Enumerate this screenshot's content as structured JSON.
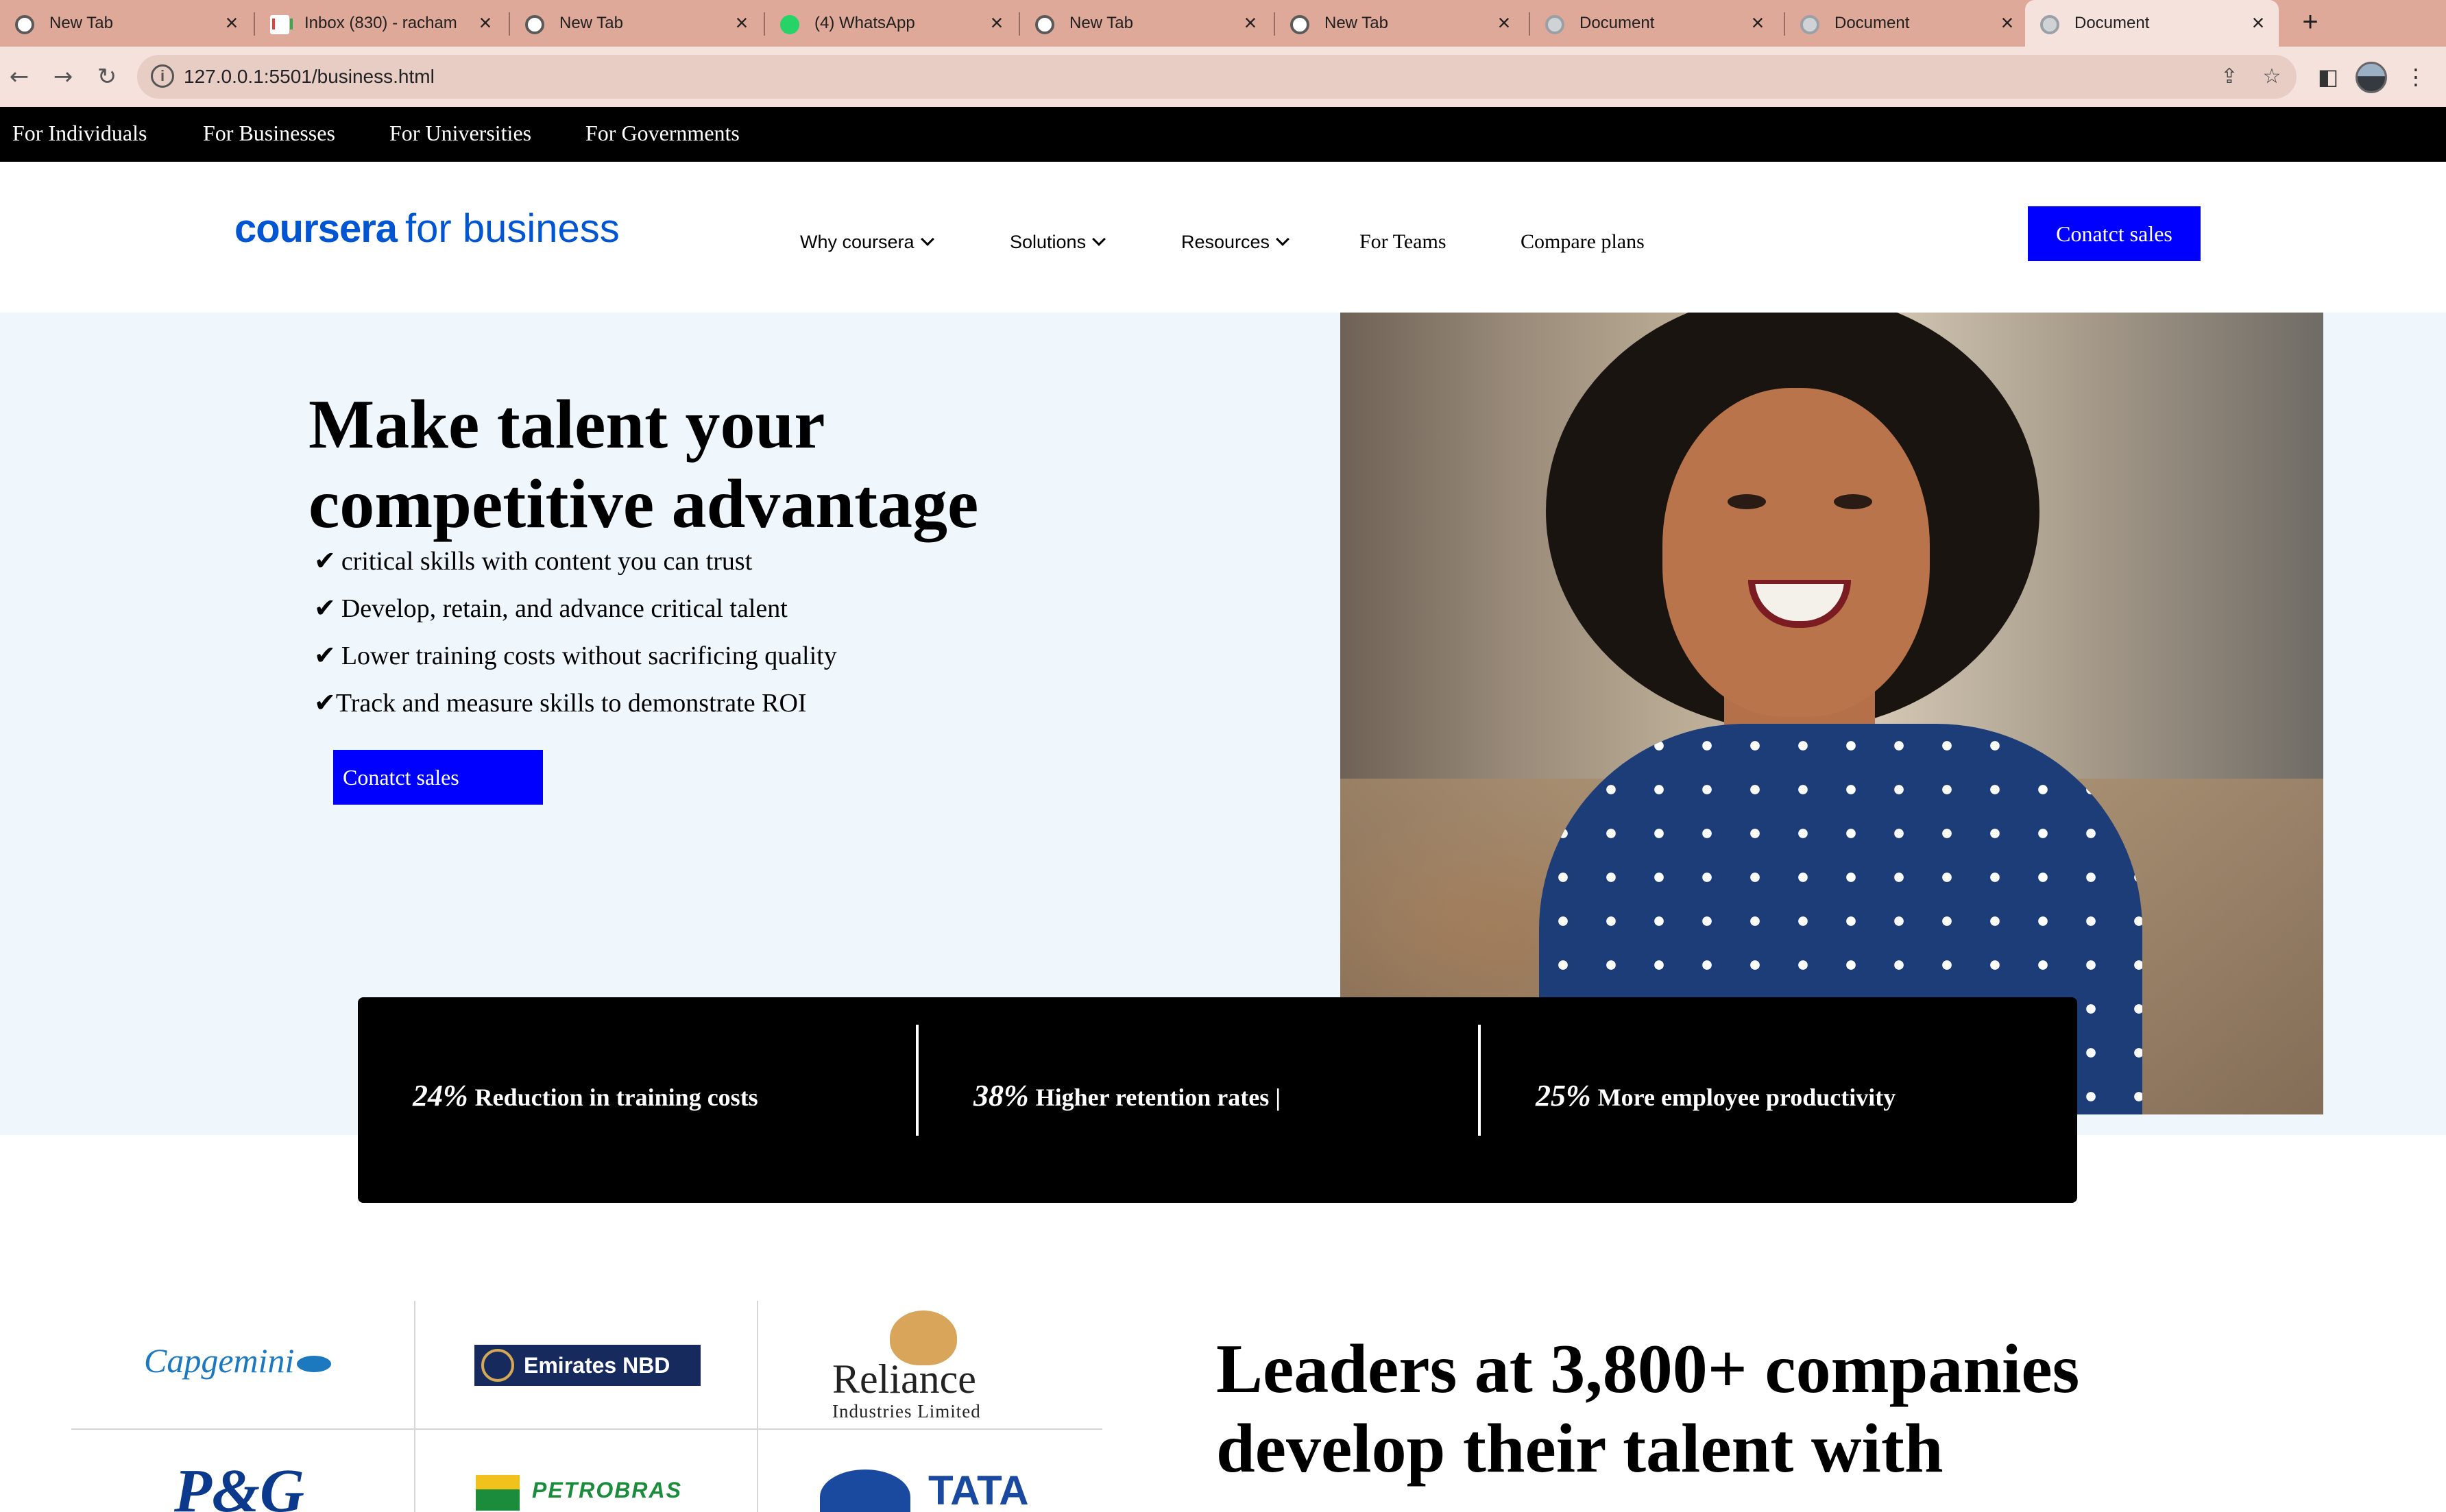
{
  "browser": {
    "tabs": [
      {
        "title": "New Tab",
        "icon": "chrome-icon"
      },
      {
        "title": "Inbox (830) - racham",
        "icon": "gmail-icon"
      },
      {
        "title": "New Tab",
        "icon": "chrome-icon"
      },
      {
        "title": "(4) WhatsApp",
        "icon": "whatsapp-icon"
      },
      {
        "title": "New Tab",
        "icon": "chrome-icon"
      },
      {
        "title": "New Tab",
        "icon": "chrome-icon"
      },
      {
        "title": "Document",
        "icon": "globe-icon"
      },
      {
        "title": "Document",
        "icon": "globe-icon"
      },
      {
        "title": "Document",
        "icon": "globe-icon",
        "active": true
      }
    ],
    "new_tab_symbol": "+",
    "close_symbol": "×",
    "url": "127.0.0.1:5501/business.html"
  },
  "audience_nav": [
    "For Individuals",
    "For Businesses",
    "For Universities",
    "For Governments"
  ],
  "header": {
    "logo_brand": "coursera",
    "logo_suffix": "for business",
    "nav": [
      {
        "label": "Why coursera",
        "dropdown": true
      },
      {
        "label": "Solutions",
        "dropdown": true
      },
      {
        "label": "Resources",
        "dropdown": true
      },
      {
        "label": "For Teams",
        "dropdown": false
      },
      {
        "label": "Compare plans",
        "dropdown": false
      }
    ],
    "cta_label": "Conatct sales"
  },
  "hero": {
    "title": "Make talent your competitive advantage",
    "check_glyph": "✔",
    "bullets": [
      "critical skills with content you can trust",
      "Develop, retain, and advance critical talent",
      "Lower training costs without sacrificing quality",
      "Track and measure skills to demonstrate ROI"
    ],
    "cta_label": "Conatct sales"
  },
  "stats": [
    {
      "value": "24%",
      "label": "Reduction in training costs"
    },
    {
      "value": "38%",
      "label": "Higher retention rates |"
    },
    {
      "value": "25%",
      "label": "More employee productivity"
    }
  ],
  "partners": {
    "logos": [
      "Capgemini",
      "Emirates NBD",
      "Reliance",
      "Industries Limited",
      "P&G",
      "PETROBRAS",
      "TATA"
    ],
    "heading": "Leaders at 3,800+ companies develop their talent with"
  },
  "colors": {
    "accent_blue": "#0000ff",
    "brand_blue": "#0056d2",
    "hero_bg": "#eff6fc",
    "topbar_bg": "#000000"
  }
}
